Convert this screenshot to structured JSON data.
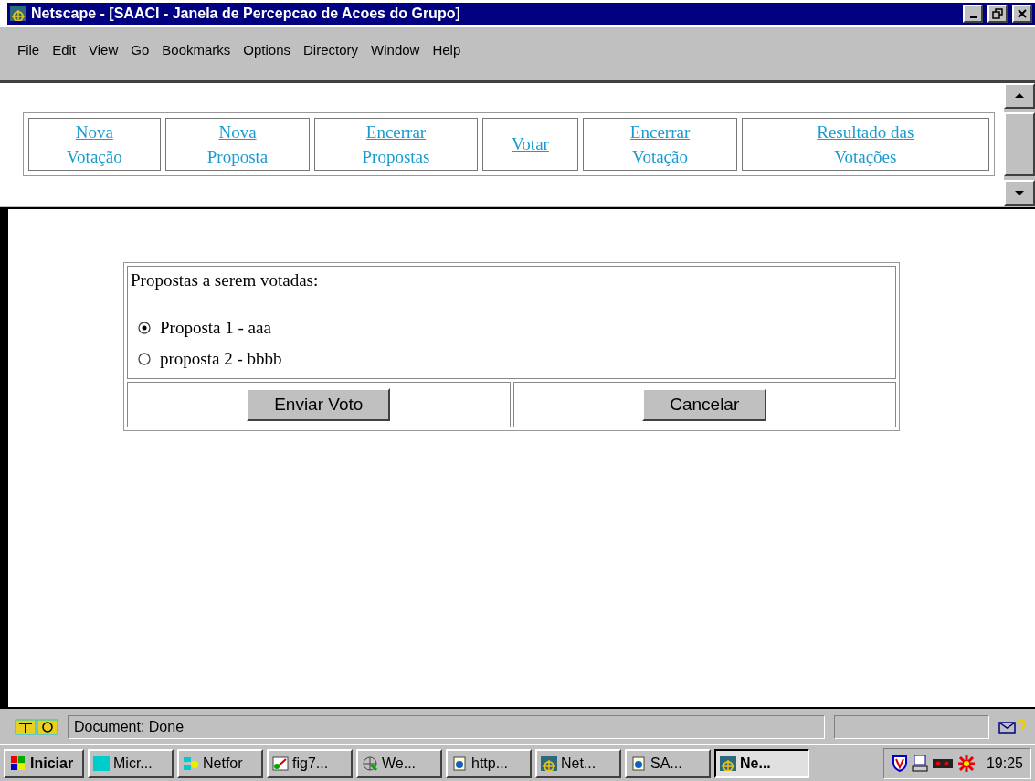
{
  "window": {
    "title": "Netscape - [SAACI - Janela de Percepcao de Acoes do Grupo]"
  },
  "menu": [
    "File",
    "Edit",
    "View",
    "Go",
    "Bookmarks",
    "Options",
    "Directory",
    "Window",
    "Help"
  ],
  "nav_links": [
    {
      "lines": [
        "Nova",
        "Votação"
      ]
    },
    {
      "lines": [
        "Nova",
        "Proposta"
      ]
    },
    {
      "lines": [
        "Encerrar",
        "Propostas"
      ]
    },
    {
      "lines": [
        "Votar"
      ]
    },
    {
      "lines": [
        "Encerrar",
        "Votação"
      ]
    },
    {
      "lines": [
        "Resultado das",
        "Votações"
      ]
    }
  ],
  "form": {
    "heading": "Propostas a serem votadas:",
    "options": [
      {
        "label": "Proposta 1 - aaa",
        "selected": true
      },
      {
        "label": "proposta 2 - bbbb",
        "selected": false
      }
    ],
    "buttons": [
      "Enviar Voto",
      "Cancelar"
    ]
  },
  "status_bar": {
    "text": "Document: Done"
  },
  "taskbar": {
    "start": "Iniciar",
    "items": [
      {
        "label": "Micr...",
        "selected": false
      },
      {
        "label": "Netfor",
        "selected": false
      },
      {
        "label": "fig7...",
        "selected": false
      },
      {
        "label": "We...",
        "selected": false
      },
      {
        "label": "http...",
        "selected": false
      },
      {
        "label": "Net...",
        "selected": false
      },
      {
        "label": "SA...",
        "selected": false
      },
      {
        "label": "Ne...",
        "selected": true
      }
    ],
    "clock": "19:25"
  }
}
